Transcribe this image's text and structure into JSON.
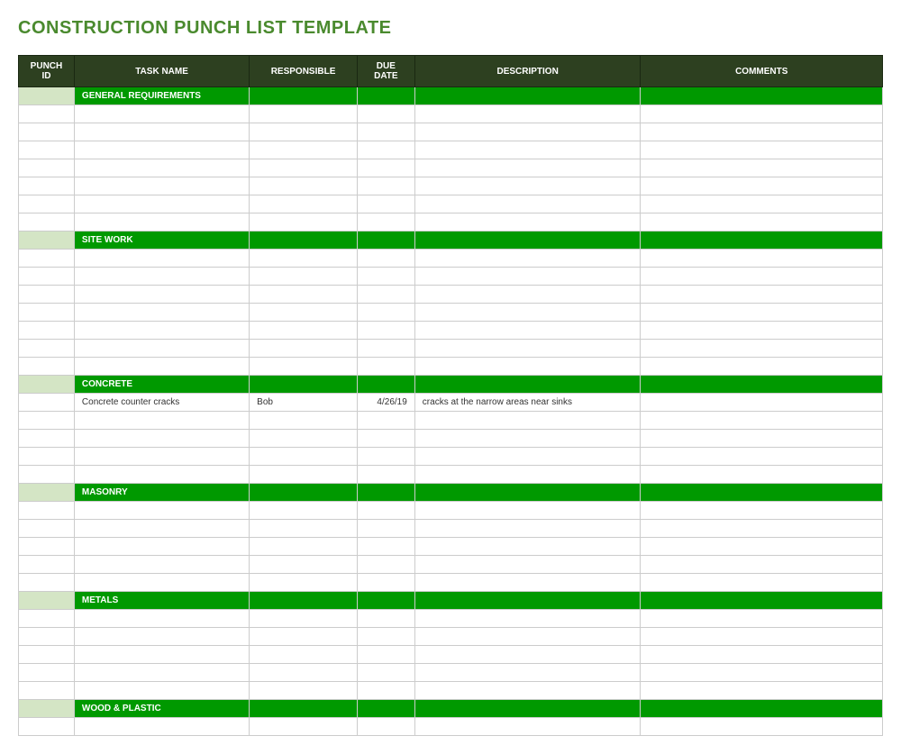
{
  "title": "CONSTRUCTION PUNCH LIST TEMPLATE",
  "columns": {
    "punch_id": "PUNCH ID",
    "task_name": "TASK NAME",
    "responsible": "RESPONSIBLE",
    "due_date": "DUE DATE",
    "description": "DESCRIPTION",
    "comments": "COMMENTS"
  },
  "sections": [
    {
      "name": "GENERAL REQUIREMENTS",
      "rows": [
        {
          "punch_id": "",
          "task_name": "",
          "responsible": "",
          "due_date": "",
          "description": "",
          "comments": ""
        },
        {
          "punch_id": "",
          "task_name": "",
          "responsible": "",
          "due_date": "",
          "description": "",
          "comments": ""
        },
        {
          "punch_id": "",
          "task_name": "",
          "responsible": "",
          "due_date": "",
          "description": "",
          "comments": ""
        },
        {
          "punch_id": "",
          "task_name": "",
          "responsible": "",
          "due_date": "",
          "description": "",
          "comments": ""
        },
        {
          "punch_id": "",
          "task_name": "",
          "responsible": "",
          "due_date": "",
          "description": "",
          "comments": ""
        },
        {
          "punch_id": "",
          "task_name": "",
          "responsible": "",
          "due_date": "",
          "description": "",
          "comments": ""
        },
        {
          "punch_id": "",
          "task_name": "",
          "responsible": "",
          "due_date": "",
          "description": "",
          "comments": ""
        }
      ]
    },
    {
      "name": "SITE WORK",
      "rows": [
        {
          "punch_id": "",
          "task_name": "",
          "responsible": "",
          "due_date": "",
          "description": "",
          "comments": ""
        },
        {
          "punch_id": "",
          "task_name": "",
          "responsible": "",
          "due_date": "",
          "description": "",
          "comments": ""
        },
        {
          "punch_id": "",
          "task_name": "",
          "responsible": "",
          "due_date": "",
          "description": "",
          "comments": ""
        },
        {
          "punch_id": "",
          "task_name": "",
          "responsible": "",
          "due_date": "",
          "description": "",
          "comments": ""
        },
        {
          "punch_id": "",
          "task_name": "",
          "responsible": "",
          "due_date": "",
          "description": "",
          "comments": ""
        },
        {
          "punch_id": "",
          "task_name": "",
          "responsible": "",
          "due_date": "",
          "description": "",
          "comments": ""
        },
        {
          "punch_id": "",
          "task_name": "",
          "responsible": "",
          "due_date": "",
          "description": "",
          "comments": ""
        }
      ]
    },
    {
      "name": "CONCRETE",
      "rows": [
        {
          "punch_id": "",
          "task_name": "Concrete counter cracks",
          "responsible": "Bob",
          "due_date": "4/26/19",
          "description": "cracks at the narrow areas near sinks",
          "comments": ""
        },
        {
          "punch_id": "",
          "task_name": "",
          "responsible": "",
          "due_date": "",
          "description": "",
          "comments": ""
        },
        {
          "punch_id": "",
          "task_name": "",
          "responsible": "",
          "due_date": "",
          "description": "",
          "comments": ""
        },
        {
          "punch_id": "",
          "task_name": "",
          "responsible": "",
          "due_date": "",
          "description": "",
          "comments": ""
        },
        {
          "punch_id": "",
          "task_name": "",
          "responsible": "",
          "due_date": "",
          "description": "",
          "comments": ""
        }
      ]
    },
    {
      "name": "MASONRY",
      "rows": [
        {
          "punch_id": "",
          "task_name": "",
          "responsible": "",
          "due_date": "",
          "description": "",
          "comments": ""
        },
        {
          "punch_id": "",
          "task_name": "",
          "responsible": "",
          "due_date": "",
          "description": "",
          "comments": ""
        },
        {
          "punch_id": "",
          "task_name": "",
          "responsible": "",
          "due_date": "",
          "description": "",
          "comments": ""
        },
        {
          "punch_id": "",
          "task_name": "",
          "responsible": "",
          "due_date": "",
          "description": "",
          "comments": ""
        },
        {
          "punch_id": "",
          "task_name": "",
          "responsible": "",
          "due_date": "",
          "description": "",
          "comments": ""
        }
      ]
    },
    {
      "name": "METALS",
      "rows": [
        {
          "punch_id": "",
          "task_name": "",
          "responsible": "",
          "due_date": "",
          "description": "",
          "comments": ""
        },
        {
          "punch_id": "",
          "task_name": "",
          "responsible": "",
          "due_date": "",
          "description": "",
          "comments": ""
        },
        {
          "punch_id": "",
          "task_name": "",
          "responsible": "",
          "due_date": "",
          "description": "",
          "comments": ""
        },
        {
          "punch_id": "",
          "task_name": "",
          "responsible": "",
          "due_date": "",
          "description": "",
          "comments": ""
        },
        {
          "punch_id": "",
          "task_name": "",
          "responsible": "",
          "due_date": "",
          "description": "",
          "comments": ""
        }
      ]
    },
    {
      "name": "WOOD & PLASTIC",
      "rows": [
        {
          "punch_id": "",
          "task_name": "",
          "responsible": "",
          "due_date": "",
          "description": "",
          "comments": ""
        }
      ]
    }
  ]
}
